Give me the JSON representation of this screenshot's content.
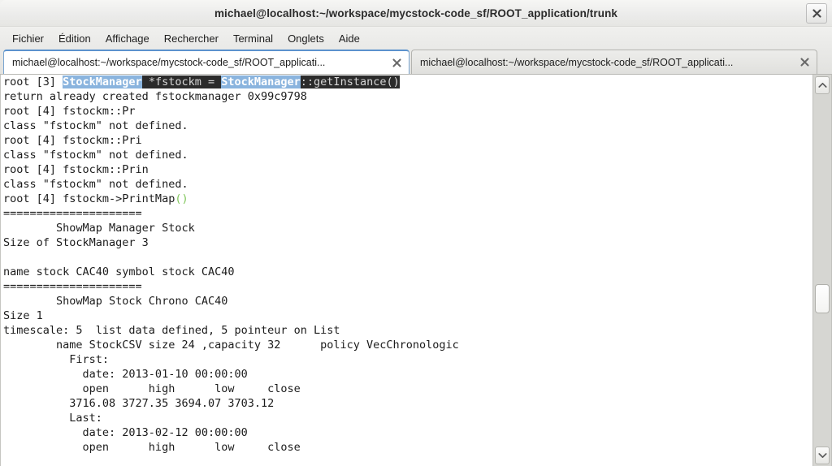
{
  "window": {
    "title": "michael@localhost:~/workspace/mycstock-code_sf/ROOT_application/trunk",
    "close_label": "✕"
  },
  "menubar": {
    "items": [
      {
        "label": "Fichier"
      },
      {
        "label": "Édition"
      },
      {
        "label": "Affichage"
      },
      {
        "label": "Rechercher"
      },
      {
        "label": "Terminal"
      },
      {
        "label": "Onglets"
      },
      {
        "label": "Aide"
      }
    ]
  },
  "tabs": [
    {
      "label": "michael@localhost:~/workspace/mycstock-code_sf/ROOT_applicati...",
      "active": true,
      "close_label": "✕"
    },
    {
      "label": "michael@localhost:~/workspace/mycstock-code_sf/ROOT_applicati...",
      "active": false,
      "close_label": "✕"
    }
  ],
  "terminal": {
    "lines": [
      {
        "id": "line-prompt-3",
        "segments": [
          {
            "text": "root [3] ",
            "style": "plain"
          },
          {
            "text": "StockManager",
            "style": "token"
          },
          {
            "text": " *fstockm = ",
            "style": "dark"
          },
          {
            "text": "StockManager",
            "style": "token"
          },
          {
            "text": "::getInstance()",
            "style": "dark"
          }
        ]
      },
      {
        "id": "line-return-ptr",
        "segments": [
          {
            "text": "return already created fstockmanager 0x99c9798",
            "style": "plain"
          }
        ]
      },
      {
        "id": "line-prompt-4a",
        "segments": [
          {
            "text": "root [4] fstockm::Pr",
            "style": "plain"
          }
        ]
      },
      {
        "id": "line-err-1",
        "segments": [
          {
            "text": "class \"fstockm\" not defined.",
            "style": "plain"
          }
        ]
      },
      {
        "id": "line-prompt-4b",
        "segments": [
          {
            "text": "root [4] fstockm::Pri",
            "style": "plain"
          }
        ]
      },
      {
        "id": "line-err-2",
        "segments": [
          {
            "text": "class \"fstockm\" not defined.",
            "style": "plain"
          }
        ]
      },
      {
        "id": "line-prompt-4c",
        "segments": [
          {
            "text": "root [4] fstockm::Prin",
            "style": "plain"
          }
        ]
      },
      {
        "id": "line-err-3",
        "segments": [
          {
            "text": "class \"fstockm\" not defined.",
            "style": "plain"
          }
        ]
      },
      {
        "id": "line-prompt-4d-printmap",
        "segments": [
          {
            "text": "root [4] fstockm->PrintMap",
            "style": "plain"
          },
          {
            "text": "()",
            "style": "green"
          }
        ]
      },
      {
        "id": "line-sep-1",
        "segments": [
          {
            "text": "=====================",
            "style": "plain"
          }
        ]
      },
      {
        "id": "line-showmap-manager",
        "segments": [
          {
            "text": "        ShowMap Manager Stock",
            "style": "plain"
          }
        ]
      },
      {
        "id": "line-size-manager",
        "segments": [
          {
            "text": "Size of StockManager 3",
            "style": "plain"
          }
        ]
      },
      {
        "id": "line-blank-1",
        "segments": [
          {
            "text": "",
            "style": "plain"
          }
        ]
      },
      {
        "id": "line-name-stock",
        "segments": [
          {
            "text": "name stock CAC40 symbol stock CAC40",
            "style": "plain"
          }
        ]
      },
      {
        "id": "line-sep-2",
        "segments": [
          {
            "text": "=====================",
            "style": "plain"
          }
        ]
      },
      {
        "id": "line-showmap-chrono",
        "segments": [
          {
            "text": "        ShowMap Stock Chrono CAC40",
            "style": "plain"
          }
        ]
      },
      {
        "id": "line-size-1",
        "segments": [
          {
            "text": "Size 1",
            "style": "plain"
          }
        ]
      },
      {
        "id": "line-timescale",
        "segments": [
          {
            "text": "timescale: 5  list data defined, 5 pointeur on List",
            "style": "plain"
          }
        ]
      },
      {
        "id": "line-name-stockcsv",
        "segments": [
          {
            "text": "        name StockCSV size 24 ,capacity 32      policy VecChronologic",
            "style": "plain"
          }
        ]
      },
      {
        "id": "line-first-label",
        "segments": [
          {
            "text": "          First:",
            "style": "plain"
          }
        ]
      },
      {
        "id": "line-first-date",
        "segments": [
          {
            "text": "            date: 2013-01-10 00:00:00",
            "style": "plain"
          }
        ]
      },
      {
        "id": "line-first-header",
        "segments": [
          {
            "text": "            open      high      low     close",
            "style": "plain"
          }
        ]
      },
      {
        "id": "line-first-values",
        "segments": [
          {
            "text": "          3716.08 3727.35 3694.07 3703.12",
            "style": "plain"
          }
        ]
      },
      {
        "id": "line-last-label",
        "segments": [
          {
            "text": "          Last:",
            "style": "plain"
          }
        ]
      },
      {
        "id": "line-last-date",
        "segments": [
          {
            "text": "            date: 2013-02-12 00:00:00",
            "style": "plain"
          }
        ]
      },
      {
        "id": "line-last-header",
        "segments": [
          {
            "text": "            open      high      low     close",
            "style": "plain"
          }
        ]
      }
    ]
  },
  "scrollbar": {
    "up_label": "▲",
    "down_label": "▼"
  }
}
